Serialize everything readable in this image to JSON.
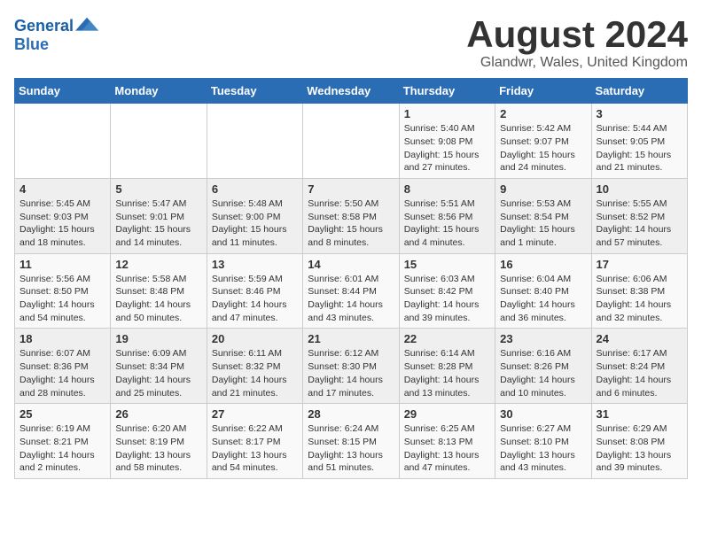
{
  "logo": {
    "text_general": "General",
    "text_blue": "Blue"
  },
  "title": "August 2024",
  "subtitle": "Glandwr, Wales, United Kingdom",
  "weekdays": [
    "Sunday",
    "Monday",
    "Tuesday",
    "Wednesday",
    "Thursday",
    "Friday",
    "Saturday"
  ],
  "weeks": [
    [
      {
        "day": "",
        "info": ""
      },
      {
        "day": "",
        "info": ""
      },
      {
        "day": "",
        "info": ""
      },
      {
        "day": "",
        "info": ""
      },
      {
        "day": "1",
        "info": "Sunrise: 5:40 AM\nSunset: 9:08 PM\nDaylight: 15 hours and 27 minutes."
      },
      {
        "day": "2",
        "info": "Sunrise: 5:42 AM\nSunset: 9:07 PM\nDaylight: 15 hours and 24 minutes."
      },
      {
        "day": "3",
        "info": "Sunrise: 5:44 AM\nSunset: 9:05 PM\nDaylight: 15 hours and 21 minutes."
      }
    ],
    [
      {
        "day": "4",
        "info": "Sunrise: 5:45 AM\nSunset: 9:03 PM\nDaylight: 15 hours and 18 minutes."
      },
      {
        "day": "5",
        "info": "Sunrise: 5:47 AM\nSunset: 9:01 PM\nDaylight: 15 hours and 14 minutes."
      },
      {
        "day": "6",
        "info": "Sunrise: 5:48 AM\nSunset: 9:00 PM\nDaylight: 15 hours and 11 minutes."
      },
      {
        "day": "7",
        "info": "Sunrise: 5:50 AM\nSunset: 8:58 PM\nDaylight: 15 hours and 8 minutes."
      },
      {
        "day": "8",
        "info": "Sunrise: 5:51 AM\nSunset: 8:56 PM\nDaylight: 15 hours and 4 minutes."
      },
      {
        "day": "9",
        "info": "Sunrise: 5:53 AM\nSunset: 8:54 PM\nDaylight: 15 hours and 1 minute."
      },
      {
        "day": "10",
        "info": "Sunrise: 5:55 AM\nSunset: 8:52 PM\nDaylight: 14 hours and 57 minutes."
      }
    ],
    [
      {
        "day": "11",
        "info": "Sunrise: 5:56 AM\nSunset: 8:50 PM\nDaylight: 14 hours and 54 minutes."
      },
      {
        "day": "12",
        "info": "Sunrise: 5:58 AM\nSunset: 8:48 PM\nDaylight: 14 hours and 50 minutes."
      },
      {
        "day": "13",
        "info": "Sunrise: 5:59 AM\nSunset: 8:46 PM\nDaylight: 14 hours and 47 minutes."
      },
      {
        "day": "14",
        "info": "Sunrise: 6:01 AM\nSunset: 8:44 PM\nDaylight: 14 hours and 43 minutes."
      },
      {
        "day": "15",
        "info": "Sunrise: 6:03 AM\nSunset: 8:42 PM\nDaylight: 14 hours and 39 minutes."
      },
      {
        "day": "16",
        "info": "Sunrise: 6:04 AM\nSunset: 8:40 PM\nDaylight: 14 hours and 36 minutes."
      },
      {
        "day": "17",
        "info": "Sunrise: 6:06 AM\nSunset: 8:38 PM\nDaylight: 14 hours and 32 minutes."
      }
    ],
    [
      {
        "day": "18",
        "info": "Sunrise: 6:07 AM\nSunset: 8:36 PM\nDaylight: 14 hours and 28 minutes."
      },
      {
        "day": "19",
        "info": "Sunrise: 6:09 AM\nSunset: 8:34 PM\nDaylight: 14 hours and 25 minutes."
      },
      {
        "day": "20",
        "info": "Sunrise: 6:11 AM\nSunset: 8:32 PM\nDaylight: 14 hours and 21 minutes."
      },
      {
        "day": "21",
        "info": "Sunrise: 6:12 AM\nSunset: 8:30 PM\nDaylight: 14 hours and 17 minutes."
      },
      {
        "day": "22",
        "info": "Sunrise: 6:14 AM\nSunset: 8:28 PM\nDaylight: 14 hours and 13 minutes."
      },
      {
        "day": "23",
        "info": "Sunrise: 6:16 AM\nSunset: 8:26 PM\nDaylight: 14 hours and 10 minutes."
      },
      {
        "day": "24",
        "info": "Sunrise: 6:17 AM\nSunset: 8:24 PM\nDaylight: 14 hours and 6 minutes."
      }
    ],
    [
      {
        "day": "25",
        "info": "Sunrise: 6:19 AM\nSunset: 8:21 PM\nDaylight: 14 hours and 2 minutes."
      },
      {
        "day": "26",
        "info": "Sunrise: 6:20 AM\nSunset: 8:19 PM\nDaylight: 13 hours and 58 minutes."
      },
      {
        "day": "27",
        "info": "Sunrise: 6:22 AM\nSunset: 8:17 PM\nDaylight: 13 hours and 54 minutes."
      },
      {
        "day": "28",
        "info": "Sunrise: 6:24 AM\nSunset: 8:15 PM\nDaylight: 13 hours and 51 minutes."
      },
      {
        "day": "29",
        "info": "Sunrise: 6:25 AM\nSunset: 8:13 PM\nDaylight: 13 hours and 47 minutes."
      },
      {
        "day": "30",
        "info": "Sunrise: 6:27 AM\nSunset: 8:10 PM\nDaylight: 13 hours and 43 minutes."
      },
      {
        "day": "31",
        "info": "Sunrise: 6:29 AM\nSunset: 8:08 PM\nDaylight: 13 hours and 39 minutes."
      }
    ]
  ]
}
